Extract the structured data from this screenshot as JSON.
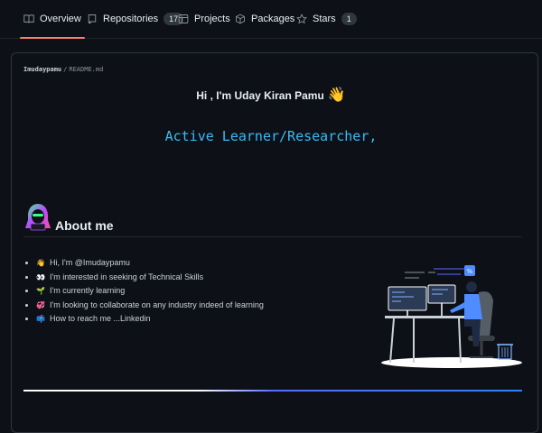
{
  "tabs": [
    {
      "label": "Overview",
      "icon": "book-icon",
      "active": true
    },
    {
      "label": "Repositories",
      "icon": "repo-icon",
      "count": "17"
    },
    {
      "label": "Projects",
      "icon": "table-icon"
    },
    {
      "label": "Packages",
      "icon": "package-icon"
    },
    {
      "label": "Stars",
      "icon": "star-icon",
      "count": "1"
    }
  ],
  "readme": {
    "owner": "Imudaypamu",
    "separator": "/",
    "file": "README.md",
    "greeting": "Hi , I'm Uday Kiran Pamu",
    "wave": "👋",
    "typing_text": "Active Learner/Researcher,",
    "about_title": "About me",
    "bullets": [
      {
        "emoji": "👋",
        "text": "Hi, I'm @Imudaypamu"
      },
      {
        "emoji": "👀",
        "text": "I'm interested in seeking of Technical Skills"
      },
      {
        "emoji": "🌱",
        "text": "I'm currently learning"
      },
      {
        "emoji": "💞",
        "text": "I'm looking to collaborate on any industry indeed of learning"
      },
      {
        "emoji": "📫",
        "text": "How to reach me ...Linkedin"
      }
    ]
  },
  "colors": {
    "background": "#0d1117",
    "accent_tab": "#f78166",
    "typing": "#36bcf7",
    "border": "#30363d"
  }
}
